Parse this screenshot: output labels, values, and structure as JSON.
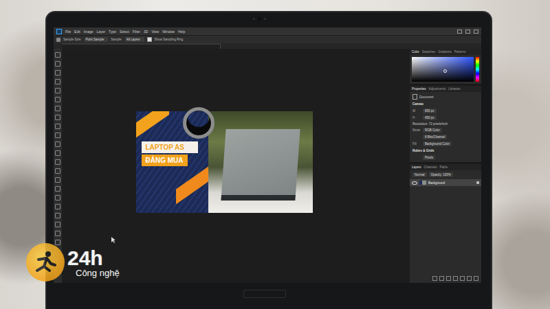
{
  "app": {
    "menu": [
      "File",
      "Edit",
      "Image",
      "Layer",
      "Type",
      "Select",
      "Filter",
      "3D",
      "View",
      "Window",
      "Help"
    ]
  },
  "options_bar": {
    "sample_size_label": "Sample Size:",
    "sample_size": "Point Sample",
    "sample_label": "Sample:",
    "sample": "All Layers",
    "show_ring": "Show Sampling Ring",
    "show_ring_checked": true
  },
  "canvas_image": {
    "headline_1": "LAPTOP AS",
    "headline_2": "ĐÁNG MUA"
  },
  "color_panel": {
    "tabs": [
      {
        "label": "Color",
        "selected": true
      },
      {
        "label": "Swatches",
        "selected": false
      },
      {
        "label": "Gradients",
        "selected": false
      },
      {
        "label": "Patterns",
        "selected": false
      }
    ]
  },
  "properties_panel": {
    "tabs": [
      {
        "label": "Properties",
        "selected": true
      },
      {
        "label": "Adjustments",
        "selected": false
      },
      {
        "label": "Libraries",
        "selected": false
      }
    ],
    "section": "Document",
    "canvas_title": "Canvas",
    "width_label": "W",
    "width": "800 px",
    "height_label": "H",
    "height": "450 px",
    "resolution": "Resolution: 72 pixels/inch",
    "mode_label": "Mode",
    "mode": "RGB Color",
    "depth": "8 Bits/Channel",
    "fill_label": "Fill",
    "fill": "Background Color",
    "rulers_title": "Rulers & Grids",
    "units": "Pixels"
  },
  "layers_panel": {
    "tabs": [
      {
        "label": "Layers",
        "selected": true
      },
      {
        "label": "Channels",
        "selected": false
      },
      {
        "label": "Paths",
        "selected": false
      }
    ],
    "blend": "Normal",
    "opacity": "Opacity: 100%",
    "layers": [
      {
        "name": "Background",
        "visible": true,
        "selected": true,
        "locked": true
      }
    ]
  },
  "watermark": {
    "logo": "24h",
    "subtitle": "Công nghệ"
  }
}
